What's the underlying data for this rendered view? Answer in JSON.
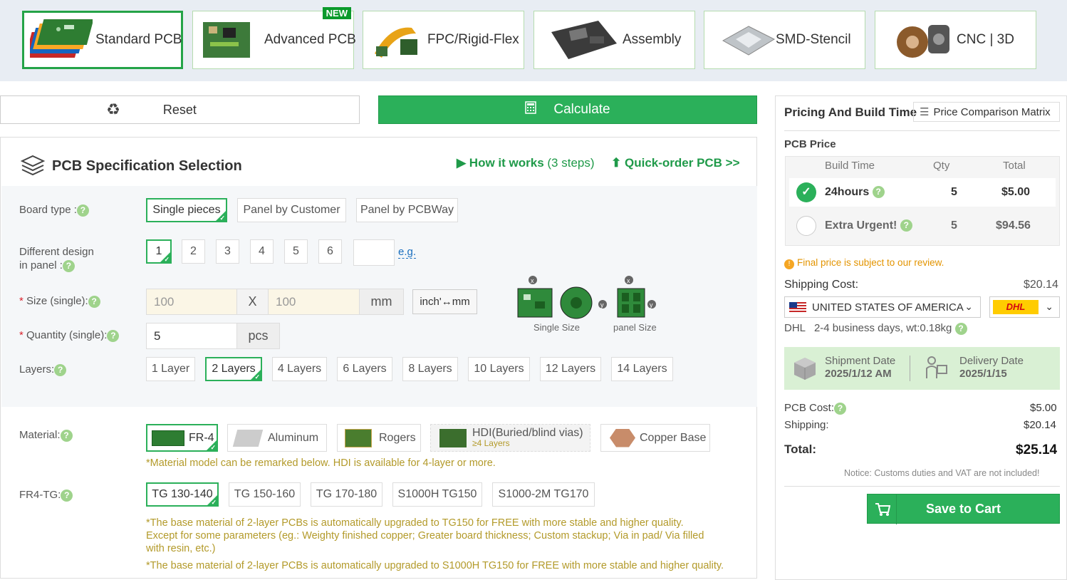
{
  "tabs": [
    {
      "label": "Standard PCB"
    },
    {
      "label": "Advanced PCB",
      "badge": "NEW"
    },
    {
      "label": "FPC/Rigid-Flex"
    },
    {
      "label": "Assembly"
    },
    {
      "label": "SMD-Stencil"
    },
    {
      "label": "CNC | 3D"
    }
  ],
  "actions": {
    "reset": "Reset",
    "calculate": "Calculate"
  },
  "spec": {
    "title": "PCB Specification Selection",
    "how": "How it works",
    "how_steps": "(3 steps)",
    "quick": "Quick-order PCB >>",
    "board_type": {
      "label": "Board type :",
      "options": [
        "Single pieces",
        "Panel by Customer",
        "Panel by PCBWay"
      ]
    },
    "designs": {
      "label1": "Different design",
      "label2": "in panel :",
      "options": [
        "1",
        "2",
        "3",
        "4",
        "5",
        "6"
      ],
      "eg": "e.g."
    },
    "size": {
      "label": "Size (single):",
      "w": "100",
      "x": "X",
      "h": "100",
      "unit": "mm",
      "toggle": "inch'↔mm"
    },
    "qty": {
      "label": "Quantity (single):",
      "value": "5",
      "unit": "pcs"
    },
    "diagram": {
      "single": "Single Size",
      "panel": "panel Size"
    },
    "layers": {
      "label": "Layers:",
      "options": [
        "1 Layer",
        "2 Layers",
        "4 Layers",
        "6 Layers",
        "8 Layers",
        "10 Layers",
        "12 Layers",
        "14 Layers"
      ]
    },
    "material": {
      "label": "Material:",
      "options": [
        "FR-4",
        "Aluminum",
        "Rogers",
        "HDI(Buried/blind vias)",
        "Copper Base"
      ],
      "hdi_sub": "≥4 Layers",
      "note": "*Material model can be remarked below. HDI is available for 4-layer or more."
    },
    "tg": {
      "label": "FR4-TG:",
      "options": [
        "TG 130-140",
        "TG 150-160",
        "TG 170-180",
        "S1000H TG150",
        "S1000-2M TG170"
      ],
      "note1": "*The base material of 2-layer PCBs is automatically upgraded to TG150 for FREE with more stable and higher quality.",
      "note2": "Except for some parameters (eg.: Weighty finished copper; Greater board thickness; Custom stackup; Via in pad/ Via filled",
      "note3": "with resin, etc.)",
      "note4": "*The base material of 2-layer PCBs is automatically upgraded to S1000H TG150 for FREE with more stable and higher quality."
    }
  },
  "pricing": {
    "title": "Pricing And Build Time",
    "matrix": "Price Comparison Matrix",
    "pcb_price": "PCB Price",
    "cols": [
      "Build Time",
      "Qty",
      "Total"
    ],
    "rows": [
      {
        "time": "24hours",
        "qty": "5",
        "total": "$5.00"
      },
      {
        "time": "Extra Urgent!",
        "qty": "5",
        "total": "$94.56"
      }
    ],
    "final_note": "Final price is subject to our review.",
    "shipping_label": "Shipping Cost:",
    "shipping_value": "$20.14",
    "country": "UNITED STATES OF AMERICA",
    "carrier": "DHL",
    "carrier_info": "DHL   2-4 business days, wt:0.18kg",
    "shipment_label": "Shipment Date",
    "shipment_date": "2025/1/12 AM",
    "delivery_label": "Delivery Date",
    "delivery_date": "2025/1/15",
    "pcb_cost_label": "PCB Cost:",
    "pcb_cost": "$5.00",
    "ship_label": "Shipping:",
    "ship": "$20.14",
    "total_label": "Total:",
    "total": "$25.14",
    "notice": "Notice: Customs duties and VAT are not included!",
    "save": "Save to Cart"
  },
  "colors": {
    "green": "#2bb05a",
    "brand_dark": "#1f9a49",
    "note": "#b39a2a",
    "req": "#d9232d"
  }
}
